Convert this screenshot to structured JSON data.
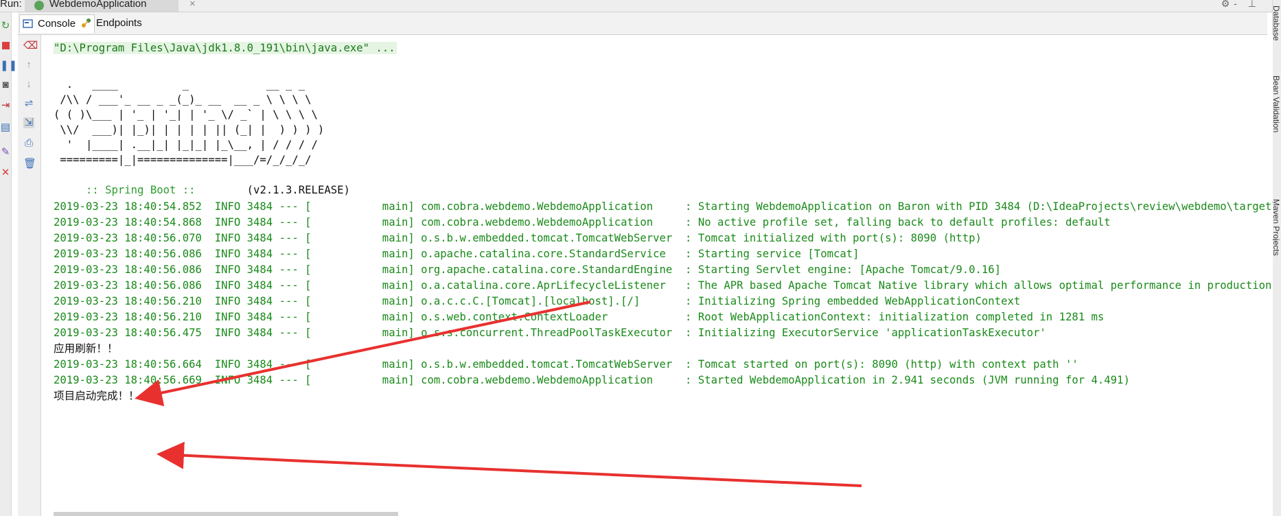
{
  "topbar": {
    "run_label": "Run:",
    "run_tab_title": "WebdemoApplication",
    "close_glyph": "×",
    "top_right_icons": "⚙- ⊥"
  },
  "subtabs": [
    {
      "label": "Console",
      "icon": "console-icon"
    },
    {
      "label": "Endpoints",
      "icon": "endpoints-icon"
    }
  ],
  "right_panel": [
    "Database",
    "Bean Validation",
    "Maven Projects"
  ],
  "console": {
    "command": "\"D:\\Program Files\\Java\\jdk1.8.0_191\\bin\\java.exe\" ...",
    "banner": [
      "  .   ____          _            __ _ _",
      " /\\\\ / ___'_ __ _ _(_)_ __  __ _ \\ \\ \\ \\",
      "( ( )\\___ | '_ | '_| | '_ \\/ _` | \\ \\ \\ \\",
      " \\\\/  ___)| |_)| | | | | || (_| |  ) ) ) )",
      "  '  |____| .__|_| |_|_| |_\\__, | / / / /",
      " =========|_|==============|___/=/_/_/_/"
    ],
    "spring_label": " :: Spring Boot ::",
    "spring_version": "        (v2.1.3.RELEASE)",
    "logs": [
      "2019-03-23 18:40:54.852  INFO 3484 --- [           main] com.cobra.webdemo.WebdemoApplication     : Starting WebdemoApplication on Baron with PID 3484 (D:\\IdeaProjects\\review\\webdemo\\target\\classes",
      "2019-03-23 18:40:54.868  INFO 3484 --- [           main] com.cobra.webdemo.WebdemoApplication     : No active profile set, falling back to default profiles: default",
      "2019-03-23 18:40:56.070  INFO 3484 --- [           main] o.s.b.w.embedded.tomcat.TomcatWebServer  : Tomcat initialized with port(s): 8090 (http)",
      "2019-03-23 18:40:56.086  INFO 3484 --- [           main] o.apache.catalina.core.StandardService   : Starting service [Tomcat]",
      "2019-03-23 18:40:56.086  INFO 3484 --- [           main] org.apache.catalina.core.StandardEngine  : Starting Servlet engine: [Apache Tomcat/9.0.16]",
      "2019-03-23 18:40:56.086  INFO 3484 --- [           main] o.a.catalina.core.AprLifecycleListener   : The APR based Apache Tomcat Native library which allows optimal performance in production environm",
      "2019-03-23 18:40:56.210  INFO 3484 --- [           main] o.a.c.c.C.[Tomcat].[localhost].[/]       : Initializing Spring embedded WebApplicationContext",
      "2019-03-23 18:40:56.210  INFO 3484 --- [           main] o.s.web.context.ContextLoader            : Root WebApplicationContext: initialization completed in 1281 ms",
      "2019-03-23 18:40:56.475  INFO 3484 --- [           main] o.s.s.concurrent.ThreadPoolTaskExecutor  : Initializing ExecutorService 'applicationTaskExecutor'"
    ],
    "msg1": "应用刷新！！",
    "logs2": [
      "2019-03-23 18:40:56.664  INFO 3484 --- [           main] o.s.b.w.embedded.tomcat.TomcatWebServer  : Tomcat started on port(s): 8090 (http) with context path ''",
      "2019-03-23 18:40:56.669  INFO 3484 --- [           main] com.cobra.webdemo.WebdemoApplication     : Started WebdemoApplication in 2.941 seconds (JVM running for 4.491)"
    ],
    "msg2": "项目启动完成！！"
  },
  "colors": {
    "log_green": "#1a8a1a",
    "annotation_red": "#e8312f"
  }
}
